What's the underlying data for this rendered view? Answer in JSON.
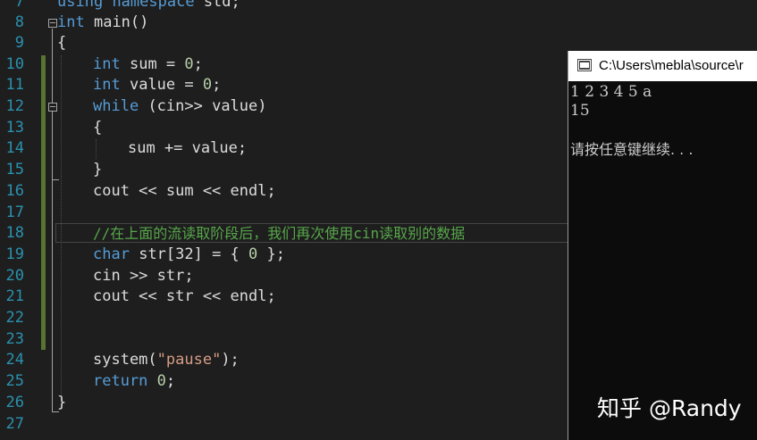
{
  "editor": {
    "line_numbers": [
      "7",
      "8",
      "9",
      "10",
      "11",
      "12",
      "13",
      "14",
      "15",
      "16",
      "17",
      "18",
      "19",
      "20",
      "21",
      "22",
      "23",
      "24",
      "25",
      "26",
      "27"
    ],
    "lines": {
      "l7": {
        "kw1": "using",
        "kw2": "namespace",
        "rest": "std;"
      },
      "l8": {
        "kw": "int",
        "rest": "main()"
      },
      "l9": {
        "text": "{"
      },
      "l10": {
        "kw": "int",
        "mid": "sum = ",
        "num": "0",
        "end": ";"
      },
      "l11": {
        "kw": "int",
        "mid": "value = ",
        "num": "0",
        "end": ";"
      },
      "l12": {
        "kw": "while",
        "rest": "(cin>> value)"
      },
      "l13": {
        "text": "{"
      },
      "l14": {
        "text": "sum += value;"
      },
      "l15": {
        "text": "}"
      },
      "l16": {
        "text": "cout << sum << endl;"
      },
      "l18": {
        "comment": "//在上面的流读取阶段后，我们再次使用cin读取别的数据"
      },
      "l19": {
        "kw": "char",
        "mid": "str[32] = { ",
        "num": "0",
        "end": " };"
      },
      "l20": {
        "text": "cin >> str;"
      },
      "l21": {
        "text": "cout << str << endl;"
      },
      "l24": {
        "pre": "system(",
        "str": "\"pause\"",
        "end": ");"
      },
      "l25": {
        "kw": "return",
        "num": "0",
        "end": ";"
      },
      "l26": {
        "text": "}"
      }
    }
  },
  "console": {
    "title": "C:\\Users\\mebla\\source\\r",
    "output": [
      "1 2 3 4 5 a",
      "15",
      "",
      "请按任意键继续. . ."
    ]
  },
  "watermark": "知乎 @Randy",
  "colors": {
    "background": "#1e1e1e",
    "keyword": "#569cd6",
    "number": "#b5cea8",
    "string": "#d69d85",
    "comment": "#57a64a",
    "line_number": "#2b91af",
    "change_bar": "#577430"
  }
}
